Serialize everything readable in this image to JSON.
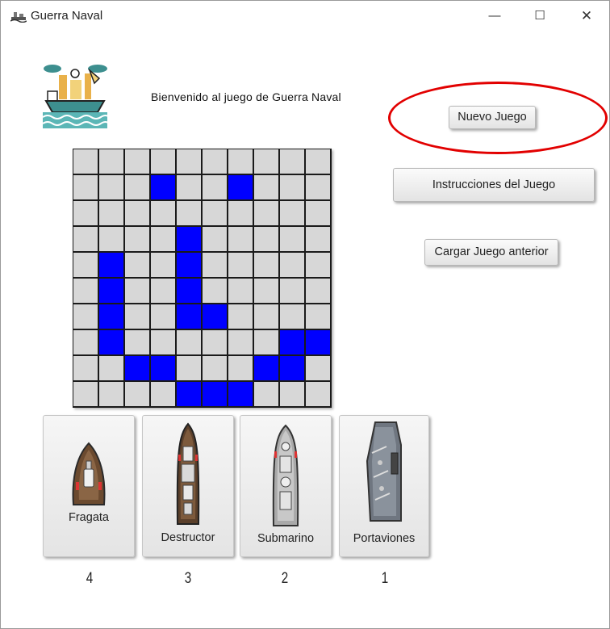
{
  "window": {
    "title": "Guerra Naval",
    "minimize": "—",
    "maximize": "☐",
    "close": "✕"
  },
  "header": {
    "welcome": "Bienvenido al juego de Guerra Naval"
  },
  "buttons": {
    "new_game": "Nuevo Juego",
    "instructions": "Instrucciones del Juego",
    "load_game": "Cargar Juego anterior"
  },
  "colors": {
    "ship_cell": "#0000ff",
    "empty_cell": "#d7d7d7",
    "highlight": "#e20000"
  },
  "board": {
    "rows": 10,
    "cols": 10,
    "ship_cells": [
      [
        1,
        3
      ],
      [
        1,
        6
      ],
      [
        3,
        4
      ],
      [
        4,
        1
      ],
      [
        4,
        4
      ],
      [
        5,
        1
      ],
      [
        5,
        4
      ],
      [
        6,
        1
      ],
      [
        6,
        4
      ],
      [
        6,
        5
      ],
      [
        7,
        1
      ],
      [
        7,
        8
      ],
      [
        7,
        9
      ],
      [
        8,
        2
      ],
      [
        8,
        3
      ],
      [
        8,
        7
      ],
      [
        8,
        8
      ],
      [
        9,
        4
      ],
      [
        9,
        5
      ],
      [
        9,
        6
      ]
    ]
  },
  "ships": [
    {
      "label": "Fragata",
      "count": "4",
      "icon": "frigate-icon"
    },
    {
      "label": "Destructor",
      "count": "3",
      "icon": "destroyer-icon"
    },
    {
      "label": "Submarino",
      "count": "2",
      "icon": "submarine-icon"
    },
    {
      "label": "Portaviones",
      "count": "1",
      "icon": "aircraft-carrier-icon"
    }
  ]
}
